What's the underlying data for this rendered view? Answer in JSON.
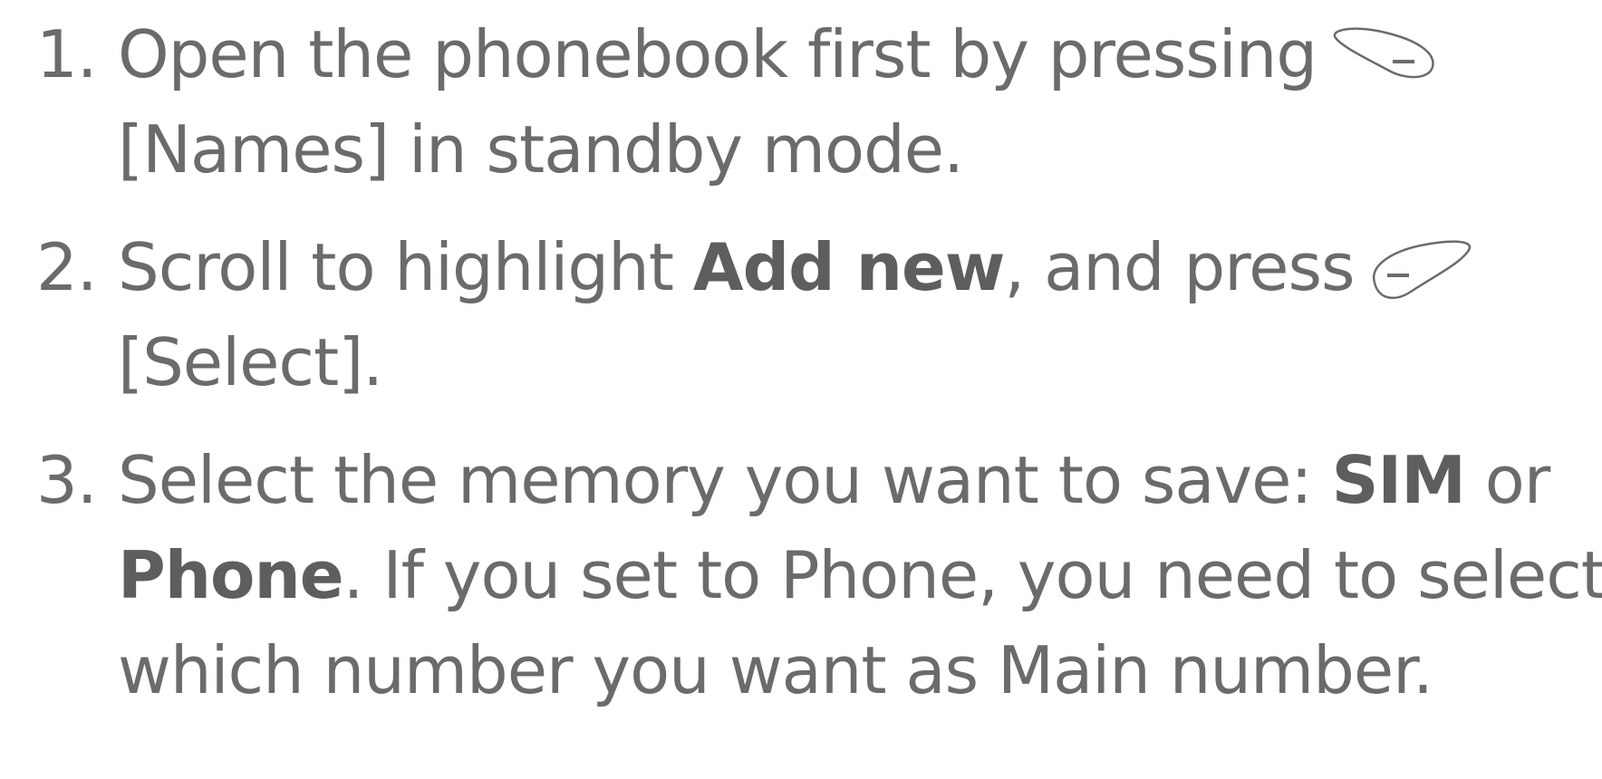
{
  "steps": [
    {
      "number": "1.",
      "line1": "Open the phonebook first by pressing",
      "icon": "left-soft-key-icon",
      "line2": "[Names] in standby mode."
    },
    {
      "number": "2.",
      "line1_pre": "Scroll to highlight ",
      "line1_bold": "Add new",
      "line1_post": ", and press",
      "icon": "right-soft-key-icon",
      "line2": "[Select]."
    },
    {
      "number": "3.",
      "line1_pre": "Select the memory you want to save: ",
      "line1_bold": "SIM",
      "line1_post": " or",
      "line2_bold": "Phone",
      "line2_post": ". If you set to Phone, you need to select",
      "line3": "which number you want as Main number."
    }
  ],
  "colors": {
    "text": "#6b6b6b",
    "icon_stroke": "#6b6b6b"
  }
}
